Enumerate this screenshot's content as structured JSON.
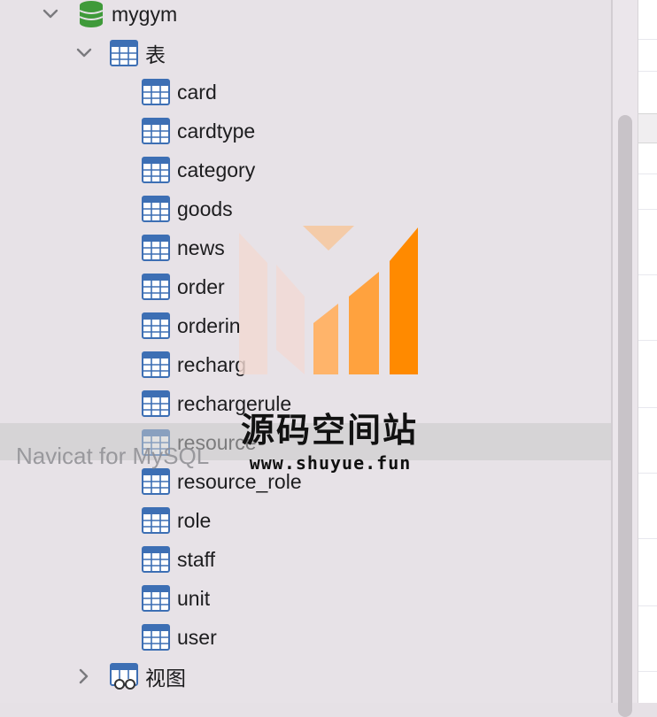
{
  "tree": {
    "database": {
      "name": "mygym",
      "expanded": true,
      "icon": "database-icon",
      "color": "#3f9a3a"
    },
    "tables_folder": {
      "label": "表",
      "expanded": true,
      "icon": "table-folder-icon"
    },
    "tables": [
      "card",
      "cardtype",
      "category",
      "goods",
      "news",
      "order",
      "orderin",
      "recharg",
      "rechargerule",
      "resource",
      "resource_role",
      "role",
      "staff",
      "unit",
      "user"
    ],
    "views_folder": {
      "label": "视图",
      "expanded": false,
      "icon": "view-folder-icon"
    }
  },
  "overlay": {
    "tooltip": "Navicat for MySQL",
    "watermark_title": "源码空间站",
    "watermark_url": "www.shuyue.fun"
  },
  "colors": {
    "table_icon": "#3d6fb4",
    "watermark_orange": "#ff8a00",
    "watermark_light": "#f6c79c"
  }
}
